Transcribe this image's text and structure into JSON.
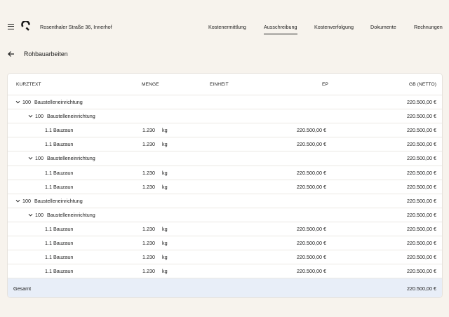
{
  "header": {
    "address": "Rosenthaler Straße 36, Innerhof",
    "nav": [
      "Kostenermittlung",
      "Ausschreibung",
      "Kostenverfolgung",
      "Dokumente",
      "Rechnungen"
    ],
    "active_nav": "Ausschreibung"
  },
  "page": {
    "title": "Rohbauarbeiten"
  },
  "table": {
    "columns": {
      "kurztext": "KURZTEXT",
      "menge": "MENGE",
      "einheit": "EINHEIT",
      "ep": "EP",
      "gb": "GB (NETTO)"
    },
    "rows": [
      {
        "type": "group",
        "level": 0,
        "num": "100",
        "label": "Baustelleneinrichtung",
        "gb": "220.500,00 €"
      },
      {
        "type": "group",
        "level": 1,
        "num": "100",
        "label": "Baustelleneinrichtung",
        "gb": "220.500,00 €"
      },
      {
        "type": "item",
        "label": "1.1 Bauzaun",
        "menge": "1.230",
        "einheit": "kg",
        "ep": "220.500,00 €",
        "gb": "220.500,00 €"
      },
      {
        "type": "item",
        "label": "1.1 Bauzaun",
        "menge": "1.230",
        "einheit": "kg",
        "ep": "220.500,00 €",
        "gb": "220.500,00 €"
      },
      {
        "type": "group",
        "level": 1,
        "num": "100",
        "label": "Baustelleneinrichtung",
        "gb": "220.500,00 €"
      },
      {
        "type": "item",
        "label": "1.1 Bauzaun",
        "menge": "1.230",
        "einheit": "kg",
        "ep": "220.500,00 €",
        "gb": "220.500,00 €"
      },
      {
        "type": "item",
        "label": "1.1 Bauzaun",
        "menge": "1.230",
        "einheit": "kg",
        "ep": "220.500,00 €",
        "gb": "220.500,00 €"
      },
      {
        "type": "group",
        "level": 0,
        "num": "100",
        "label": "Baustelleneinrichtung",
        "gb": "220.500,00 €"
      },
      {
        "type": "group",
        "level": 1,
        "num": "100",
        "label": "Baustelleneinrichtung",
        "gb": "220.500,00 €"
      },
      {
        "type": "item",
        "label": "1.1 Bauzaun",
        "menge": "1.230",
        "einheit": "kg",
        "ep": "220.500,00 €",
        "gb": "220.500,00 €"
      },
      {
        "type": "item",
        "label": "1.1 Bauzaun",
        "menge": "1.230",
        "einheit": "kg",
        "ep": "220.500,00 €",
        "gb": "220.500,00 €"
      },
      {
        "type": "item",
        "label": "1.1 Bauzaun",
        "menge": "1.230",
        "einheit": "kg",
        "ep": "220.500,00 €",
        "gb": "220.500,00 €"
      },
      {
        "type": "item",
        "label": "1.1 Bauzaun",
        "menge": "1.230",
        "einheit": "kg",
        "ep": "220.500,00 €",
        "gb": "220.500,00 €"
      }
    ],
    "total": {
      "label": "Gesamt",
      "gb": "220.500,00 €"
    }
  },
  "icons": {
    "menu": "hamburger-icon",
    "logo": "brand-logo-icon",
    "back": "arrow-left-icon",
    "expand": "chevron-down-icon"
  },
  "colors": {
    "background": "#f7f3ed",
    "total_row": "#e8eef8",
    "text": "#1b1b1b"
  }
}
